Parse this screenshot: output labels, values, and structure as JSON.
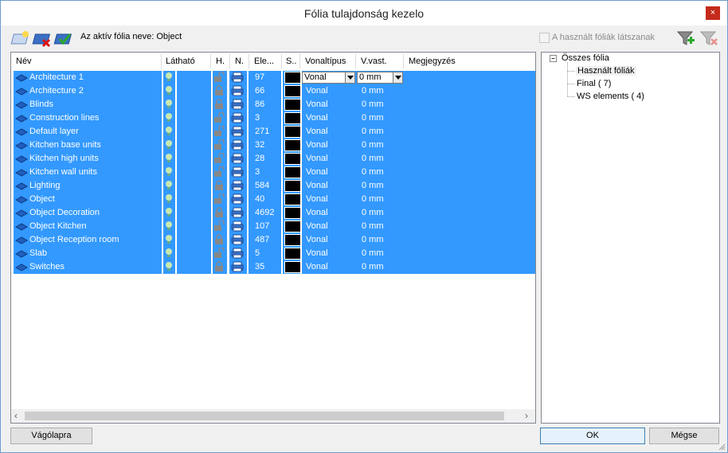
{
  "window": {
    "title": "Fólia tulajdonság kezelo",
    "close_glyph": "×"
  },
  "toolbar": {
    "active_label": "Az aktív fólia neve: Object",
    "used_checkbox_label": "A használt fóliák látszanak"
  },
  "grid": {
    "columns": [
      "Név",
      "Látható",
      "H.",
      "N.",
      "Ele...",
      "S..",
      "Vonaltípus",
      "V.vast.",
      "Megjegyzés"
    ],
    "rows": [
      {
        "name": "Architecture 1",
        "count": "97",
        "linetype": "Vonal",
        "width": "0 mm",
        "locked": false
      },
      {
        "name": "Architecture 2",
        "count": "66",
        "linetype": "Vonal",
        "width": "0 mm",
        "locked": true
      },
      {
        "name": "Blinds",
        "count": "86",
        "linetype": "Vonal",
        "width": "0 mm",
        "locked": true
      },
      {
        "name": "Construction lines",
        "count": "3",
        "linetype": "Vonal",
        "width": "0 mm",
        "locked": false
      },
      {
        "name": "Default layer",
        "count": "271",
        "linetype": "Vonal",
        "width": "0 mm",
        "locked": false
      },
      {
        "name": "Kitchen base units",
        "count": "32",
        "linetype": "Vonal",
        "width": "0 mm",
        "locked": false
      },
      {
        "name": "Kitchen high units",
        "count": "28",
        "linetype": "Vonal",
        "width": "0 mm",
        "locked": false
      },
      {
        "name": "Kitchen wall units",
        "count": "3",
        "linetype": "Vonal",
        "width": "0 mm",
        "locked": false
      },
      {
        "name": "Lighting",
        "count": "584",
        "linetype": "Vonal",
        "width": "0 mm",
        "locked": true
      },
      {
        "name": "Object",
        "count": "40",
        "linetype": "Vonal",
        "width": "0 mm",
        "locked": false
      },
      {
        "name": "Object Decoration",
        "count": "4692",
        "linetype": "Vonal",
        "width": "0 mm",
        "locked": true
      },
      {
        "name": "Object Kitchen",
        "count": "107",
        "linetype": "Vonal",
        "width": "0 mm",
        "locked": false
      },
      {
        "name": "Object Reception room",
        "count": "487",
        "linetype": "Vonal",
        "width": "0 mm",
        "locked": true
      },
      {
        "name": "Slab",
        "count": "5",
        "linetype": "Vonal",
        "width": "0 mm",
        "locked": false
      },
      {
        "name": "Switches",
        "count": "35",
        "linetype": "Vonal",
        "width": "0 mm",
        "locked": true
      }
    ],
    "selection_color": "#3399ff"
  },
  "tree": {
    "root": "Összes fólia",
    "children": [
      "Használt fóliák",
      "Final (  7)",
      "WS elements (  4)"
    ]
  },
  "buttons": {
    "clipboard": "Vágólapra",
    "ok": "OK",
    "cancel": "Mégse"
  }
}
